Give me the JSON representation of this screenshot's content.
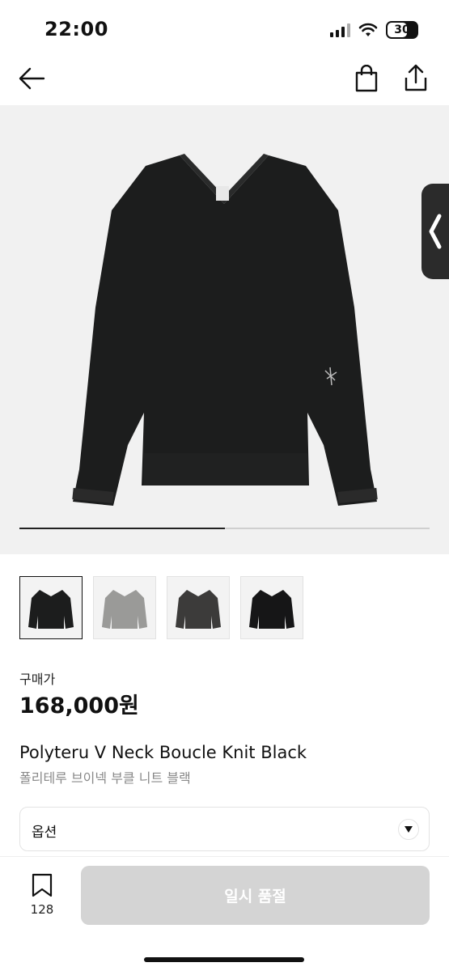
{
  "status_bar": {
    "time": "22:00",
    "battery": "30"
  },
  "nav": {
    "back_icon": "arrow-left-icon",
    "bag_icon": "shopping-bag-icon",
    "share_icon": "share-icon"
  },
  "gallery": {
    "progress": 0.5
  },
  "thumbnails": [
    {
      "name": "black-sweater"
    },
    {
      "name": "grey-sweater"
    },
    {
      "name": "charcoal-sweater"
    },
    {
      "name": "black-sweater-alt"
    }
  ],
  "pricing": {
    "label": "구매가",
    "price": "168,000원"
  },
  "product": {
    "name": "Polyteru V Neck Boucle Knit Black",
    "subtitle": "폴리테루 브이넥 부클 니트 블랙"
  },
  "options": {
    "label": "옵션"
  },
  "bottom": {
    "wish_count": "128",
    "buy_label": "일시 품절"
  },
  "colors": {
    "button_disabled": "#d4d4d4",
    "text": "#111111",
    "subtext": "#888888"
  }
}
